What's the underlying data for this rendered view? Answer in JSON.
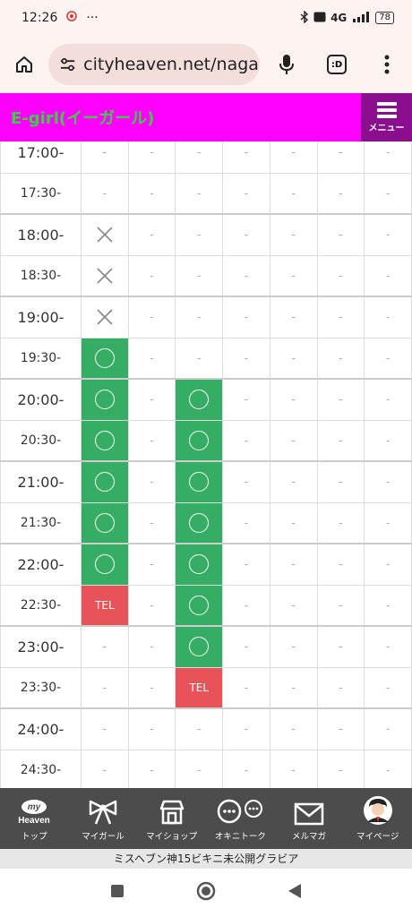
{
  "status_bar": {
    "time": "12:26",
    "dots": "···",
    "network": "4G",
    "battery": "78"
  },
  "browser": {
    "url": "cityheaven.net/nagas",
    "tab_icon": ":D"
  },
  "site": {
    "title": "E-girl(イーガール)",
    "menu_label": "メニュー"
  },
  "schedule": {
    "rows": [
      {
        "time": "17:00-",
        "hour": true,
        "cells": [
          "-",
          "-",
          "-",
          "-",
          "-",
          "-",
          "-"
        ]
      },
      {
        "time": "17:30-",
        "hour": false,
        "cells": [
          "-",
          "-",
          "-",
          "-",
          "-",
          "-",
          "-"
        ]
      },
      {
        "time": "18:00-",
        "hour": true,
        "cells": [
          "x",
          "-",
          "-",
          "-",
          "-",
          "-",
          "-"
        ]
      },
      {
        "time": "18:30-",
        "hour": false,
        "cells": [
          "x",
          "-",
          "-",
          "-",
          "-",
          "-",
          "-"
        ]
      },
      {
        "time": "19:00-",
        "hour": true,
        "cells": [
          "x",
          "-",
          "-",
          "-",
          "-",
          "-",
          "-"
        ]
      },
      {
        "time": "19:30-",
        "hour": false,
        "cells": [
          "o",
          "-",
          "-",
          "-",
          "-",
          "-",
          "-"
        ]
      },
      {
        "time": "20:00-",
        "hour": true,
        "cells": [
          "o",
          "-",
          "o",
          "-",
          "-",
          "-",
          "-"
        ]
      },
      {
        "time": "20:30-",
        "hour": false,
        "cells": [
          "o",
          "-",
          "o",
          "-",
          "-",
          "-",
          "-"
        ]
      },
      {
        "time": "21:00-",
        "hour": true,
        "cells": [
          "o",
          "-",
          "o",
          "-",
          "-",
          "-",
          "-"
        ]
      },
      {
        "time": "21:30-",
        "hour": false,
        "cells": [
          "o",
          "-",
          "o",
          "-",
          "-",
          "-",
          "-"
        ]
      },
      {
        "time": "22:00-",
        "hour": true,
        "cells": [
          "o",
          "-",
          "o",
          "-",
          "-",
          "-",
          "-"
        ]
      },
      {
        "time": "22:30-",
        "hour": false,
        "cells": [
          "TEL",
          "-",
          "o",
          "-",
          "-",
          "-",
          "-"
        ]
      },
      {
        "time": "23:00-",
        "hour": true,
        "cells": [
          "-",
          "-",
          "o",
          "-",
          "-",
          "-",
          "-"
        ]
      },
      {
        "time": "23:30-",
        "hour": false,
        "cells": [
          "-",
          "-",
          "TEL",
          "-",
          "-",
          "-",
          "-"
        ]
      },
      {
        "time": "24:00-",
        "hour": true,
        "cells": [
          "-",
          "-",
          "-",
          "-",
          "-",
          "-",
          "-"
        ]
      },
      {
        "time": "24:30-",
        "hour": false,
        "cells": [
          "-",
          "-",
          "-",
          "-",
          "-",
          "-",
          "-"
        ]
      }
    ]
  },
  "bottom_nav": {
    "items": [
      {
        "label": "トップ",
        "icon": "my-heaven-logo-icon"
      },
      {
        "label": "マイガール",
        "icon": "ribbon-icon"
      },
      {
        "label": "マイショップ",
        "icon": "shop-icon"
      },
      {
        "label": "オキニトーク",
        "icon": "chat-bubbles-icon"
      },
      {
        "label": "メルマガ",
        "icon": "mail-icon"
      },
      {
        "label": "マイページ",
        "icon": "avatar-icon"
      }
    ],
    "logo_top": "my",
    "logo_bottom": "Heaven"
  },
  "banner": {
    "text": "ミスヘブン神15ビキニ未公開グラビア"
  },
  "colors": {
    "header": "#ff00ff",
    "title": "#36d33f",
    "menu": "#8b0e8f",
    "available": "#35ad64",
    "tel": "#e8535a"
  }
}
